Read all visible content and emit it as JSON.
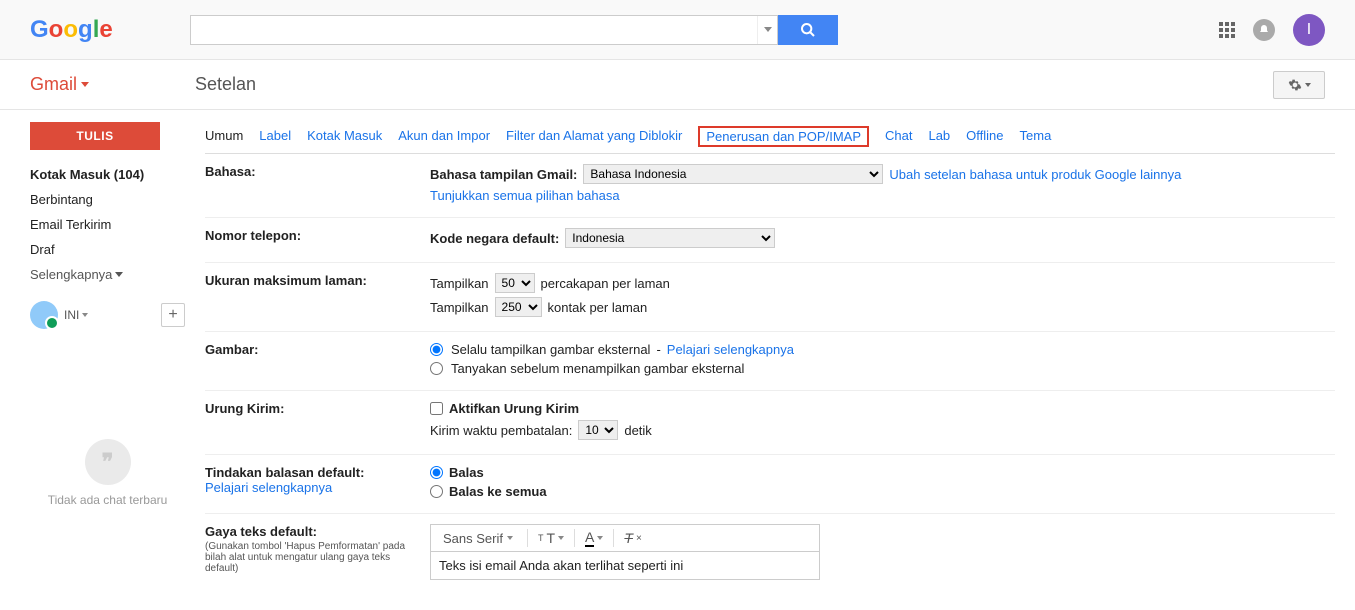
{
  "header": {
    "logo_text": "Google",
    "avatar_initial": "I"
  },
  "subheader": {
    "gmail_label": "Gmail",
    "page_title": "Setelan"
  },
  "sidebar": {
    "compose": "TULIS",
    "items": [
      {
        "label": "Kotak Masuk (104)",
        "bold": true
      },
      {
        "label": "Berbintang",
        "bold": false
      },
      {
        "label": "Email Terkirim",
        "bold": false
      },
      {
        "label": "Draf",
        "bold": false
      }
    ],
    "more": "Selengkapnya",
    "chat_name": "INI",
    "hangouts_text": "Tidak ada chat terbaru"
  },
  "tabs": [
    {
      "label": "Umum",
      "active": true
    },
    {
      "label": "Label"
    },
    {
      "label": "Kotak Masuk"
    },
    {
      "label": "Akun dan Impor"
    },
    {
      "label": "Filter dan Alamat yang Diblokir"
    },
    {
      "label": "Penerusan dan POP/IMAP",
      "highlighted": true
    },
    {
      "label": "Chat"
    },
    {
      "label": "Lab"
    },
    {
      "label": "Offline"
    },
    {
      "label": "Tema"
    }
  ],
  "settings": {
    "language": {
      "label": "Bahasa:",
      "display_label": "Bahasa tampilan Gmail:",
      "value": "Bahasa Indonesia",
      "product_link": "Ubah setelan bahasa untuk produk Google lainnya",
      "show_all": "Tunjukkan semua pilihan bahasa"
    },
    "phone": {
      "label": "Nomor telepon:",
      "code_label": "Kode negara default:",
      "value": "Indonesia"
    },
    "pagesize": {
      "label": "Ukuran maksimum laman:",
      "show1": "Tampilkan",
      "val1": "50",
      "suffix1": "percakapan per laman",
      "show2": "Tampilkan",
      "val2": "250",
      "suffix2": "kontak per laman"
    },
    "images": {
      "label": "Gambar:",
      "opt1": "Selalu tampilkan gambar eksternal",
      "learn": "Pelajari selengkapnya",
      "opt2": "Tanyakan sebelum menampilkan gambar eksternal"
    },
    "undo": {
      "label": "Urung Kirim:",
      "enable": "Aktifkan Urung Kirim",
      "cancel_label": "Kirim waktu pembatalan:",
      "val": "10",
      "suffix": "detik"
    },
    "reply": {
      "label": "Tindakan balasan default:",
      "learn": "Pelajari selengkapnya",
      "opt1": "Balas",
      "opt2": "Balas ke semua"
    },
    "textstyle": {
      "label": "Gaya teks default:",
      "sub": "(Gunakan tombol 'Hapus Pemformatan' pada bilah alat untuk mengatur ulang gaya teks default)",
      "font": "Sans Serif",
      "preview": "Teks isi email Anda akan terlihat seperti ini"
    }
  }
}
